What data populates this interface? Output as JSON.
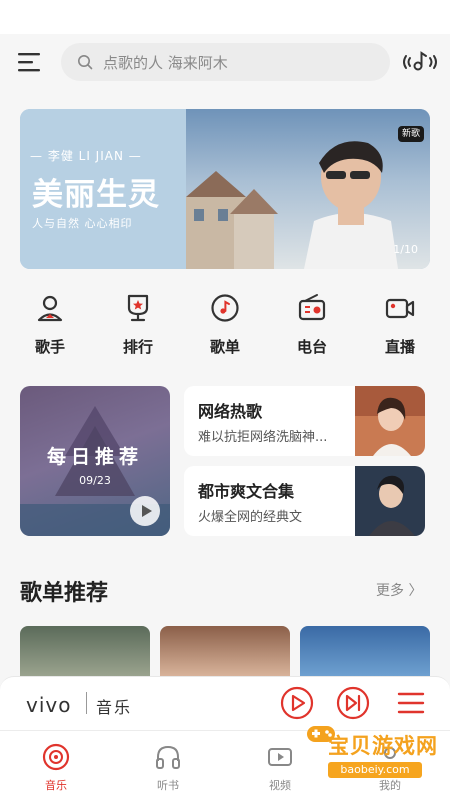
{
  "header": {
    "search_placeholder": "点歌的人 海来阿木"
  },
  "banner": {
    "artist_line": "— 李健 LI JIAN —",
    "title": "美丽生灵",
    "slogan": "人与自然 心心相印",
    "tag": "新歌",
    "page": "1/10"
  },
  "quick_nav": [
    {
      "label": "歌手",
      "icon": "singer-icon"
    },
    {
      "label": "排行",
      "icon": "ranking-icon"
    },
    {
      "label": "歌单",
      "icon": "playlist-icon"
    },
    {
      "label": "电台",
      "icon": "radio-icon"
    },
    {
      "label": "直播",
      "icon": "live-icon"
    }
  ],
  "daily": {
    "title": "每日推荐",
    "date": "09/23"
  },
  "cards": [
    {
      "title": "网络热歌",
      "subtitle": "难以抗拒网络洗脑神..."
    },
    {
      "title": "都市爽文合集",
      "subtitle": "火爆全网的经典文"
    }
  ],
  "section": {
    "title": "歌单推荐",
    "more": "更多 〉"
  },
  "player": {
    "logo": "vivo",
    "logo_cn": "音乐"
  },
  "tabs": [
    {
      "label": "音乐",
      "icon": "music-disc-icon",
      "active": true
    },
    {
      "label": "听书",
      "icon": "headphones-icon"
    },
    {
      "label": "视频",
      "icon": "video-icon"
    },
    {
      "label": "我的",
      "icon": "profile-icon"
    }
  ],
  "watermark": {
    "text": "宝贝游戏网",
    "url": "baobeiy.com"
  },
  "colors": {
    "accent": "#e0342c",
    "watermark": "#f4a21e"
  }
}
